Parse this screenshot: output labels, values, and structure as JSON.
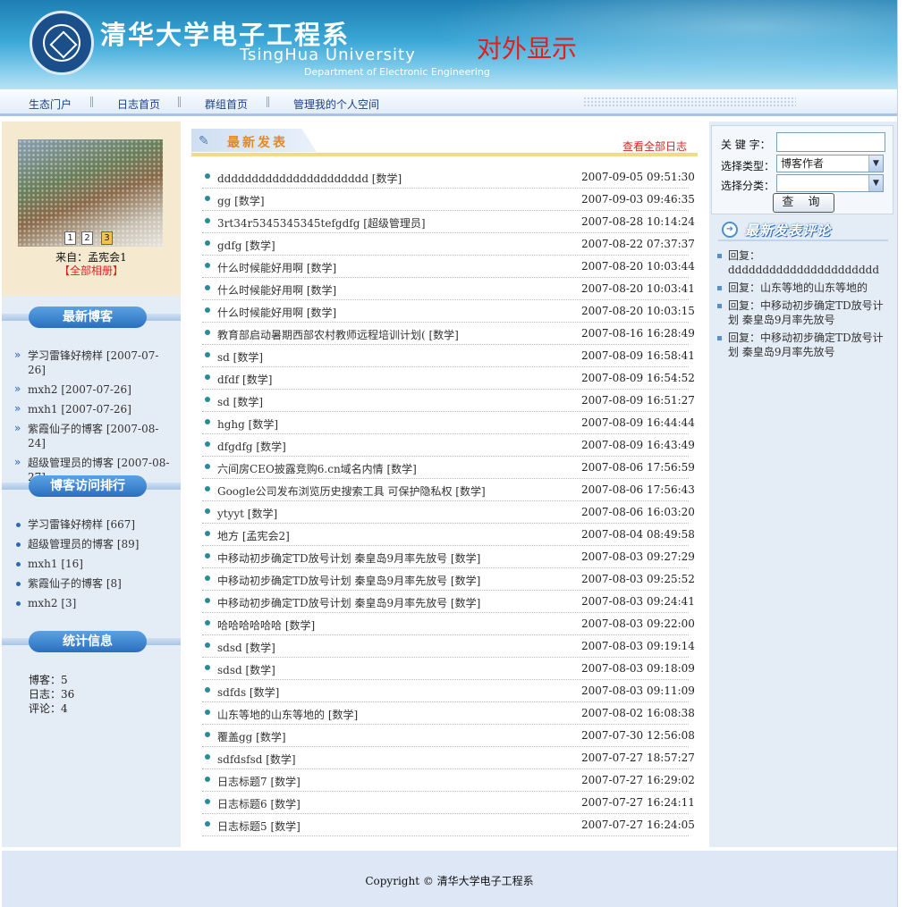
{
  "header": {
    "title_cn": "清华大学电子工程系",
    "title_en": "TsingHua University",
    "dept": "Department of Electronic Engineering",
    "external_label": "对外显示"
  },
  "nav": {
    "items": [
      "生态门户",
      "日志首页",
      "群组首页",
      "管理我的个人空间"
    ]
  },
  "left": {
    "pages": [
      "1",
      "2",
      "3"
    ],
    "active_page": "3",
    "from": "来自：孟宪会1",
    "album": "【全部相册】",
    "latest_blogs_title": "最新博客",
    "latest_blogs": [
      "学习雷锋好榜样  [2007-07-26]",
      "mxh2 [2007-07-26]",
      "mxh1 [2007-07-26]",
      "紫霞仙子的博客  [2007-08-24]",
      "超级管理员的博客  [2007-08-27]"
    ],
    "ranking_title": "博客访问排行",
    "ranking": [
      "学习雷锋好榜样  [667]",
      "超级管理员的博客  [89]",
      "mxh1 [16]",
      "紫霞仙子的博客  [8]",
      "mxh2 [3]"
    ],
    "stats_title": "统计信息",
    "stats": [
      "博客：5",
      "日志：36",
      "评论：4"
    ]
  },
  "middle": {
    "section_title": "最新发表",
    "view_all": "查看全部日志",
    "posts": [
      {
        "title": "dddddddddddddddddddddd [数学]",
        "date": "2007-09-05 09:51:30"
      },
      {
        "title": "gg [数学]",
        "date": "2007-09-03 09:46:35"
      },
      {
        "title": "3rt34r5345345345tefgdfg [超级管理员]",
        "date": "2007-08-28 10:14:24"
      },
      {
        "title": "gdfg [数学]",
        "date": "2007-08-22 07:37:37"
      },
      {
        "title": "什么时候能好用啊  [数学]",
        "date": "2007-08-20 10:03:44"
      },
      {
        "title": "什么时候能好用啊  [数学]",
        "date": "2007-08-20 10:03:41"
      },
      {
        "title": "什么时候能好用啊  [数学]",
        "date": "2007-08-20 10:03:15"
      },
      {
        "title": "教育部启动暑期西部农村教师远程培训计划( [数学]",
        "date": "2007-08-16 16:28:49"
      },
      {
        "title": "sd [数学]",
        "date": "2007-08-09 16:58:41"
      },
      {
        "title": "dfdf [数学]",
        "date": "2007-08-09 16:54:52"
      },
      {
        "title": "sd [数学]",
        "date": "2007-08-09 16:51:27"
      },
      {
        "title": "hghg [数学]",
        "date": "2007-08-09 16:44:44"
      },
      {
        "title": "dfgdfg [数学]",
        "date": "2007-08-09 16:43:49"
      },
      {
        "title": "六间房CEO披露竞购6.cn域名内情  [数学]",
        "date": "2007-08-06 17:56:59"
      },
      {
        "title": "Google公司发布浏览历史搜索工具  可保护隐私权  [数学]",
        "date": "2007-08-06 17:56:43"
      },
      {
        "title": "ytyyt [数学]",
        "date": "2007-08-06 16:03:20"
      },
      {
        "title": "地方  [孟宪会2]",
        "date": "2007-08-04 08:49:58"
      },
      {
        "title": "中移动初步确定TD放号计划  秦皇岛9月率先放号  [数学]",
        "date": "2007-08-03 09:27:29"
      },
      {
        "title": "中移动初步确定TD放号计划  秦皇岛9月率先放号  [数学]",
        "date": "2007-08-03 09:25:52"
      },
      {
        "title": "中移动初步确定TD放号计划  秦皇岛9月率先放号  [数学]",
        "date": "2007-08-03 09:24:41"
      },
      {
        "title": "哈哈哈哈哈哈  [数学]",
        "date": "2007-08-03 09:22:00"
      },
      {
        "title": "sdsd [数学]",
        "date": "2007-08-03 09:19:14"
      },
      {
        "title": "sdsd [数学]",
        "date": "2007-08-03 09:18:09"
      },
      {
        "title": "sdfds [数学]",
        "date": "2007-08-03 09:11:09"
      },
      {
        "title": "山东等地的山东等地的  [数学]",
        "date": "2007-08-02 16:08:38"
      },
      {
        "title": "覆盖gg [数学]",
        "date": "2007-07-30 12:56:08"
      },
      {
        "title": "sdfdsfsd [数学]",
        "date": "2007-07-27 18:57:27"
      },
      {
        "title": "日志标题7 [数学]",
        "date": "2007-07-27 16:29:02"
      },
      {
        "title": "日志标题6 [数学]",
        "date": "2007-07-27 16:24:11"
      },
      {
        "title": "日志标题5 [数学]",
        "date": "2007-07-27 16:24:05"
      }
    ]
  },
  "right": {
    "keyword_label": "关 键 字：",
    "keyword_value": "",
    "type_label": "选择类型：",
    "type_value": "博客作者",
    "category_label": "选择分类：",
    "category_value": "",
    "query_label": "查 询",
    "comments_title": "最新发表评论",
    "comments": [
      "回复：dddddddddddddddddddddd",
      "回复：山东等地的山东等地的",
      "回复：中移动初步确定TD放号计划  秦皇岛9月率先放号",
      "回复：中移动初步确定TD放号计划  秦皇岛9月率先放号"
    ]
  },
  "footer": {
    "copyright": "Copyright © 清华大学电子工程系"
  },
  "colors": {
    "header_blue": "#2a95cc",
    "nav_text": "#1b3f8a",
    "accent_red": "#dd2222",
    "pill_blue": "#2a6fbf",
    "left_bg": "#e4ecf6"
  }
}
